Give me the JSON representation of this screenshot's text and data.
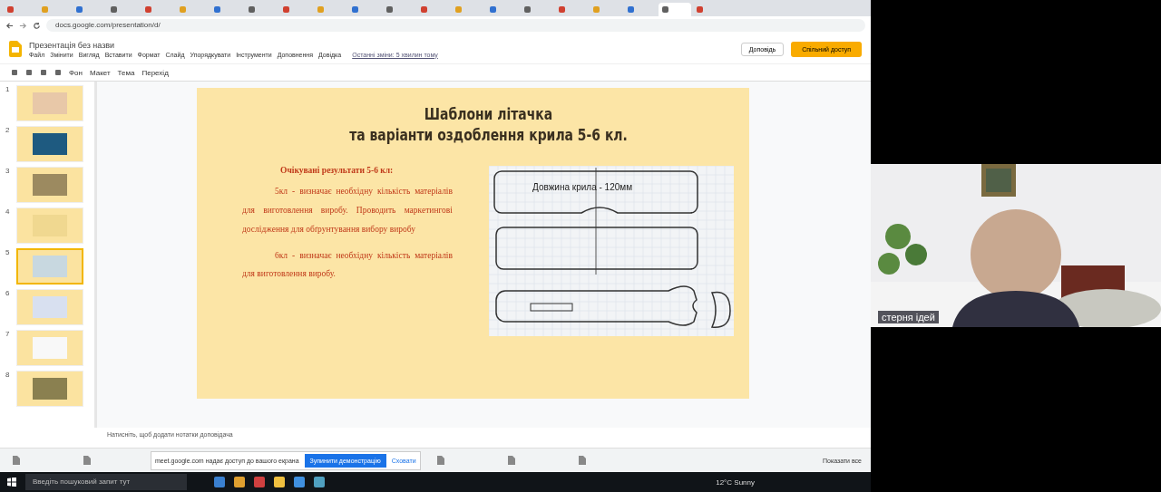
{
  "browser": {
    "tabs": [
      {
        "selected": false
      },
      {
        "selected": false
      },
      {
        "selected": false
      },
      {
        "selected": false
      },
      {
        "selected": false
      },
      {
        "selected": false
      },
      {
        "selected": false
      },
      {
        "selected": false
      },
      {
        "selected": false
      },
      {
        "selected": false
      },
      {
        "selected": false
      },
      {
        "selected": false
      },
      {
        "selected": false
      },
      {
        "selected": false
      },
      {
        "selected": false
      },
      {
        "selected": false
      },
      {
        "selected": false
      },
      {
        "selected": false
      },
      {
        "selected": false
      },
      {
        "selected": true
      },
      {
        "selected": false
      }
    ],
    "url": "docs.google.com/presentation/d/"
  },
  "docs": {
    "title": "Презентація без назви",
    "menu": [
      "Файл",
      "Змінити",
      "Вигляд",
      "Вставити",
      "Формат",
      "Слайд",
      "Упорядкувати",
      "Інструменти",
      "Доповнення",
      "Довідка"
    ],
    "last_edit": "Останні зміни: 5 хвилин тому",
    "present": "Доповідь",
    "share": "Спільний доступ",
    "toolbar_labels": [
      "Фон",
      "Макет",
      "Тема",
      "Перехід"
    ]
  },
  "slides": [
    {
      "number": "1",
      "selected": false
    },
    {
      "number": "2",
      "selected": false
    },
    {
      "number": "3",
      "selected": false
    },
    {
      "number": "4",
      "selected": false
    },
    {
      "number": "5",
      "selected": true
    },
    {
      "number": "6",
      "selected": false
    },
    {
      "number": "7",
      "selected": false
    },
    {
      "number": "8",
      "selected": false
    }
  ],
  "slide": {
    "title": [
      "Шаблони літачка",
      "та варіанти оздоблення крила 5-6 кл."
    ],
    "heading": "Очікувані результати 5-6 кл:",
    "paragraphs": [
      "5кл - визначає необхідну кількість матеріалів для виготовлення виробу. Проводить маркетингові дослідження для обґрунтування вибору виробу",
      "6кл - визначає необхідну кількість матеріалів для виготовлення виробу."
    ],
    "drawing_label": "Довжина крила - 120мм"
  },
  "notes_placeholder": "Натисніть, щоб додати нотатки доповідача",
  "share_bar": {
    "message": "meet.google.com надає доступ до вашого екрана",
    "stop": "Зупинити демонстрацію",
    "hide": "Сховати"
  },
  "downloads": {
    "show_all": "Показати все"
  },
  "taskbar": {
    "search_placeholder": "Введіть пошуковий запит тут",
    "weather": "12°C Sunny"
  },
  "webcam": {
    "name": "стерня ідей"
  }
}
